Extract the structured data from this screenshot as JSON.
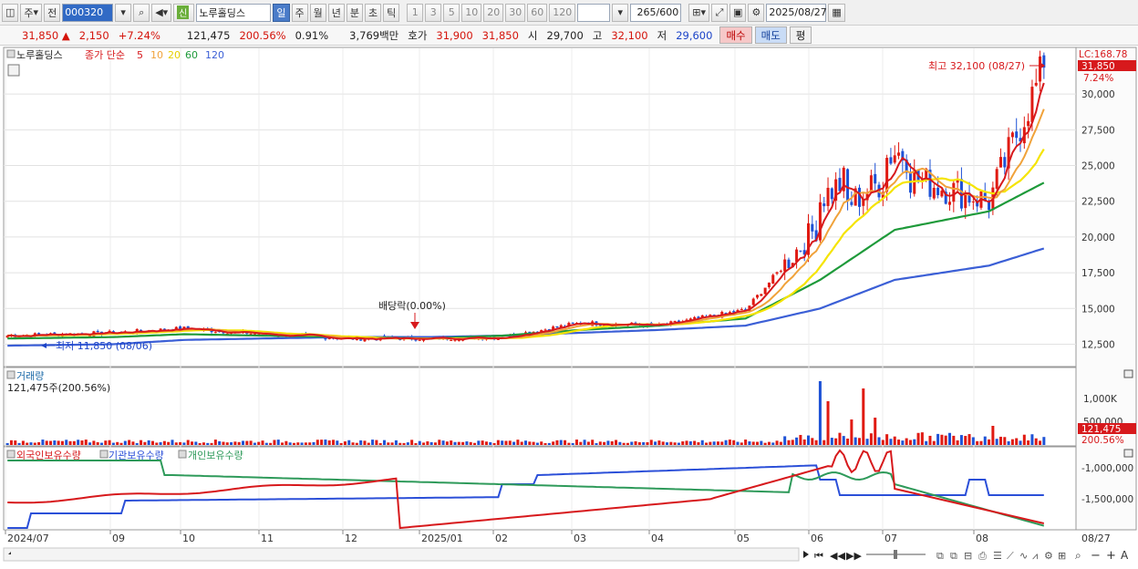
{
  "toolbar": {
    "market_type": "주",
    "prev_label": "전",
    "stock_code": "000320",
    "stock_name": "노루홀딩스",
    "shin_badge": "신",
    "periods": [
      "일",
      "주",
      "월",
      "년",
      "분",
      "초",
      "틱"
    ],
    "selected_period": "일",
    "intervals": [
      "1",
      "3",
      "5",
      "10",
      "20",
      "30",
      "60",
      "120"
    ],
    "count_value": "265",
    "count_max": "/600",
    "date": "2025/08/27"
  },
  "quote": {
    "price": "31,850",
    "up_arrow": "▲",
    "change": "2,150",
    "change_pct": "+7.24%",
    "volume": "121,475",
    "volume_pct": "200.56%",
    "turnover": "0.91%",
    "amount": "3,769백만",
    "bid_label": "호가",
    "ask": "31,900",
    "bid": "31,850",
    "open_label": "시",
    "open": "29,700",
    "high_label": "고",
    "high": "32,100",
    "low_label": "저",
    "low": "29,600",
    "buy_button": "매수",
    "sell_button": "매도",
    "avg_button": "평"
  },
  "price_panel": {
    "legend_name": "노루홀딩스",
    "legend_ma": "종가 단순",
    "ma_periods": [
      "5",
      "10",
      "20",
      "60",
      "120"
    ],
    "ma_colors": [
      "#d7191c",
      "#f0a23a",
      "#f5e400",
      "#1e9a3a",
      "#3b5fd6"
    ],
    "lc_label": "LC:168.78",
    "current_price_tag": "31,850",
    "current_pct_tag": "7.24%",
    "high_annotation": "최고 32,100 (08/27)",
    "low_annotation": "최저 11,850 (08/06)",
    "dividend_annotation": "배당락(0.00%)",
    "y_ticks": [
      "30,000",
      "27,500",
      "25,000",
      "22,500",
      "20,000",
      "17,500",
      "15,000",
      "12,500"
    ]
  },
  "volume_panel": {
    "title": "거래량",
    "value_text": "121,475주(200.56%)",
    "y_ticks": [
      "1,000K",
      "500,000"
    ],
    "current_tag": "121,475",
    "current_pct_tag": "200.56%"
  },
  "holding_panel": {
    "legend": [
      "외국인보유수량",
      "기관보유수량",
      "개인보유수량"
    ],
    "legend_colors": [
      "#d7191c",
      "#2b4fd8",
      "#2e9a5a"
    ],
    "y_ticks": [
      "-1,000,000",
      "-1,500,000"
    ]
  },
  "x_axis": {
    "labels": [
      "2024/07",
      "09",
      "10",
      "11",
      "12",
      "2025/01",
      "02",
      "03",
      "04",
      "05",
      "06",
      "07",
      "08"
    ],
    "right_label": "08/27"
  },
  "chart_data": {
    "type": "candlestick",
    "title": "노루홀딩스",
    "y_axis_ticks": [
      12500,
      15000,
      17500,
      20000,
      22500,
      25000,
      27500,
      30000
    ],
    "high": {
      "value": 32100,
      "date": "08/27"
    },
    "low": {
      "value": 11850,
      "date": "08/06"
    },
    "last_close": 31850,
    "ma_close_approx": {
      "months": [
        "2024/07",
        "09",
        "10",
        "11",
        "12",
        "2025/01",
        "02",
        "03",
        "04",
        "05",
        "06",
        "07",
        "08",
        "08/27"
      ],
      "close": [
        13100,
        13300,
        13600,
        13200,
        12900,
        12900,
        13000,
        14000,
        13800,
        14900,
        21000,
        24500,
        22500,
        31850
      ],
      "ma60": [
        12900,
        13000,
        13200,
        13100,
        13000,
        12900,
        13100,
        13500,
        13800,
        14300,
        17000,
        20500,
        21800,
        23800
      ],
      "ma120": [
        12400,
        12500,
        12800,
        12900,
        13000,
        13000,
        13100,
        13300,
        13500,
        13800,
        15000,
        17000,
        18000,
        19200
      ]
    }
  }
}
